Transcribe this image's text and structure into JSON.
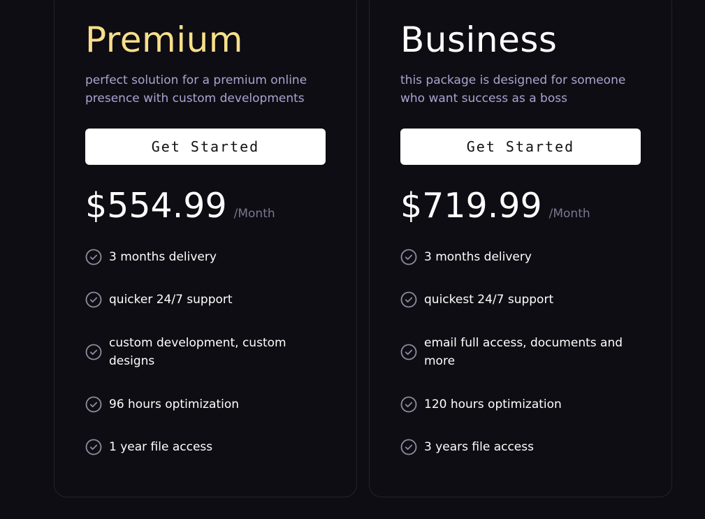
{
  "plans": [
    {
      "title": "Premium",
      "subtitle": "perfect solution for a premium online presence with custom developments",
      "cta_label": "Get Started",
      "price": "$554.99",
      "period": "/Month",
      "features": [
        "3 months delivery",
        "quicker 24/7 support",
        "custom development, custom designs",
        "96 hours optimization",
        "1 year file access"
      ]
    },
    {
      "title": "Business",
      "subtitle": "this package is designed for someone who want success as a boss",
      "cta_label": "Get Started",
      "price": "$719.99",
      "period": "/Month",
      "features": [
        "3 months delivery",
        "quickest 24/7 support",
        "email full access, documents and more",
        "120 hours optimization",
        "3 years file access"
      ]
    }
  ],
  "colors": {
    "background": "#0e0d13",
    "premium_title": "#f7df8a",
    "subtitle": "#aba4d1",
    "period": "#7a7690",
    "card_border": "#24232c"
  },
  "icons": {
    "feature_bullet": "check-circle-icon"
  }
}
